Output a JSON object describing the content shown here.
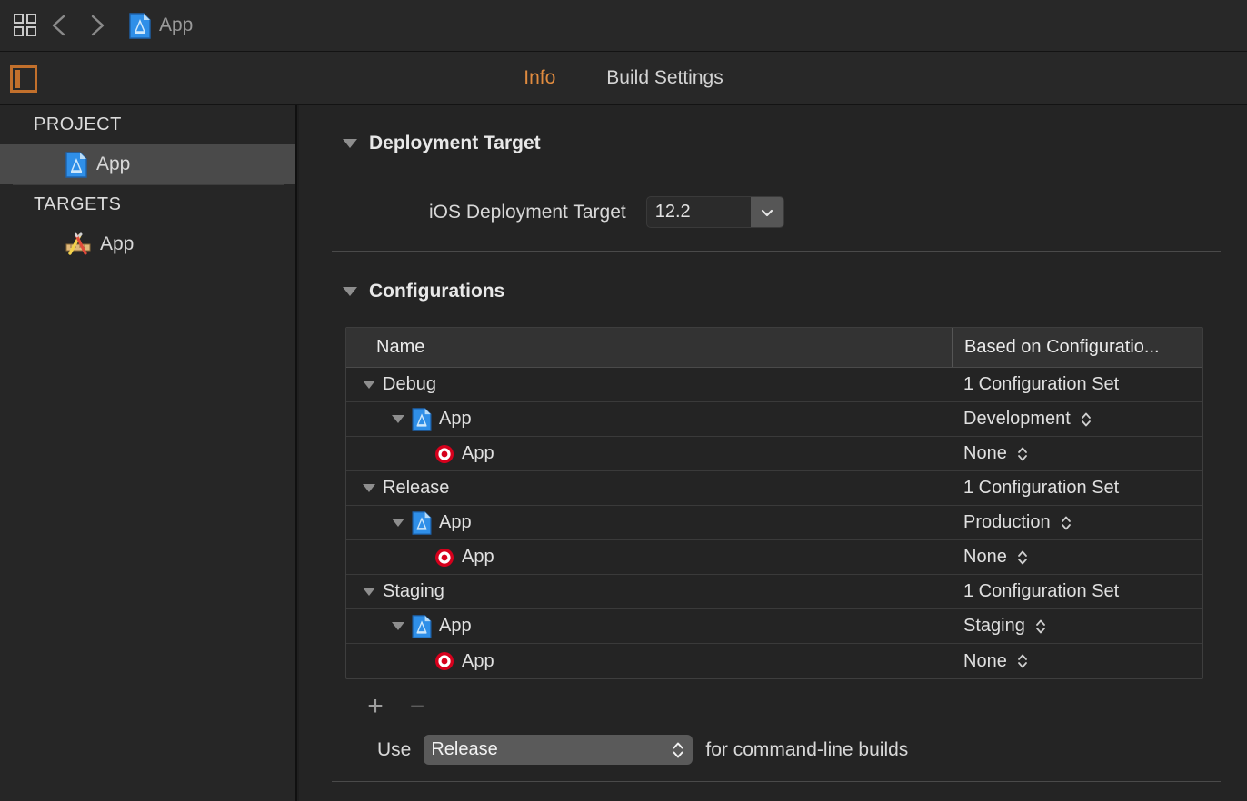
{
  "toolbar": {
    "navigator_icon": "grid-icon",
    "back_icon": "chevron-left-icon",
    "forward_icon": "chevron-right-icon",
    "breadcrumb_icon": "xcode-project-icon",
    "breadcrumb_title": "App"
  },
  "tabbar": {
    "panel_toggle_icon": "sidebar-toggle-icon",
    "tabs": [
      {
        "label": "Info",
        "active": true
      },
      {
        "label": "Build Settings",
        "active": false
      }
    ]
  },
  "sidebar": {
    "project_header": "PROJECT",
    "project_items": [
      {
        "label": "App",
        "icon": "xcode-project-icon",
        "selected": true
      }
    ],
    "targets_header": "TARGETS",
    "target_items": [
      {
        "label": "App",
        "icon": "target-ruler-pencil-icon",
        "selected": false
      }
    ]
  },
  "main": {
    "deployment": {
      "section_title": "Deployment Target",
      "field_label": "iOS Deployment Target",
      "value": "12.2",
      "dropdown_icon": "chevron-down-icon"
    },
    "configurations": {
      "section_title": "Configurations",
      "columns": [
        {
          "key": "name",
          "label": "Name"
        },
        {
          "key": "based_on",
          "label": "Based on Configuratio..."
        }
      ],
      "rows": [
        {
          "name": "Debug",
          "based_on": "1 Configuration Set",
          "level": 0,
          "icon": "none",
          "expanded": true,
          "has_stepper": false
        },
        {
          "name": "App",
          "based_on": "Development",
          "level": 1,
          "icon": "xcode-project-icon",
          "expanded": true,
          "has_stepper": true
        },
        {
          "name": "App",
          "based_on": "None",
          "level": 2,
          "icon": "target-bullseye-icon",
          "expanded": null,
          "has_stepper": true
        },
        {
          "name": "Release",
          "based_on": "1 Configuration Set",
          "level": 0,
          "icon": "none",
          "expanded": true,
          "has_stepper": false
        },
        {
          "name": "App",
          "based_on": "Production",
          "level": 1,
          "icon": "xcode-project-icon",
          "expanded": true,
          "has_stepper": true
        },
        {
          "name": "App",
          "based_on": "None",
          "level": 2,
          "icon": "target-bullseye-icon",
          "expanded": null,
          "has_stepper": true
        },
        {
          "name": "Staging",
          "based_on": "1 Configuration Set",
          "level": 0,
          "icon": "none",
          "expanded": true,
          "has_stepper": false
        },
        {
          "name": "App",
          "based_on": "Staging",
          "level": 1,
          "icon": "xcode-project-icon",
          "expanded": true,
          "has_stepper": true
        },
        {
          "name": "App",
          "based_on": "None",
          "level": 2,
          "icon": "target-bullseye-icon",
          "expanded": null,
          "has_stepper": true
        }
      ],
      "add_button": "+",
      "remove_button": "−",
      "command_line": {
        "prefix": "Use",
        "value": "Release",
        "suffix": "for command-line builds",
        "stepper_icon": "stepper-updown-icon"
      }
    }
  },
  "colors": {
    "accent": "#e08b3f",
    "window_bg": "#242424",
    "toolbar_bg": "#282828",
    "sidebar_bg": "#262626",
    "selection": "#4a4a4a",
    "target_red": "#d6001c",
    "project_blue": "#3a9bf0"
  }
}
